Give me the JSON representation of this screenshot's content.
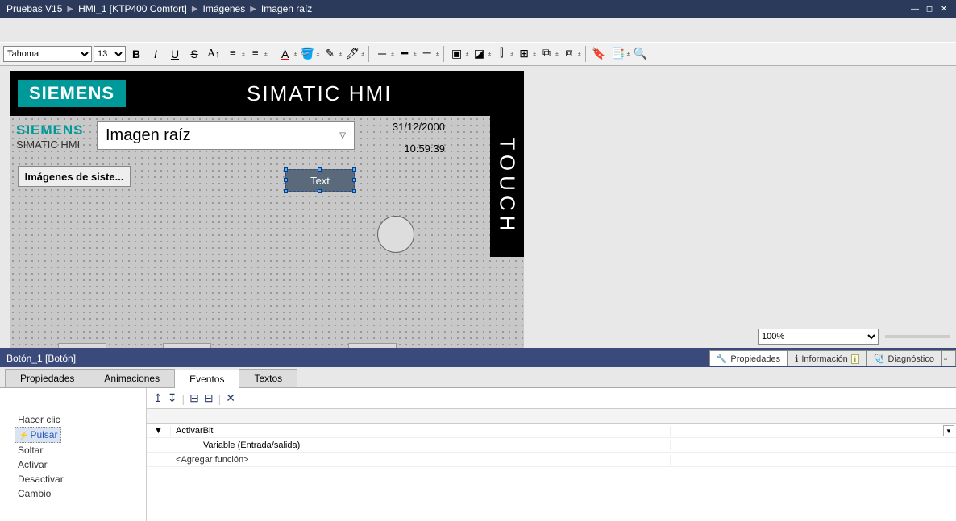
{
  "titlebar": {
    "crumbs": [
      "Pruebas V15",
      "HMI_1 [KTP400 Comfort]",
      "Imágenes",
      "Imagen raíz"
    ]
  },
  "toolbar": {
    "font": "Tahoma",
    "size": "13"
  },
  "hmi": {
    "brand": "SIEMENS",
    "product": "SIMATIC HMI",
    "sub_brand": "SIEMENS",
    "sub_product": "SIMATIC HMI",
    "touch": "TOUCH",
    "screen_title": "Imagen raíz",
    "date": "31/12/2000",
    "time": "10:59:39",
    "sys_btn": "Imágenes de siste...",
    "text_btn": "Text"
  },
  "zoom": "100%",
  "lower": {
    "title": "Botón_1 [Botón]",
    "rtabs": {
      "prop": "Propiedades",
      "info": "Información",
      "diag": "Diagnóstico"
    },
    "tabs": {
      "prop": "Propiedades",
      "anim": "Animaciones",
      "event": "Eventos",
      "text": "Textos"
    },
    "events": {
      "click": "Hacer clic",
      "press": "Pulsar",
      "release": "Soltar",
      "activate": "Activar",
      "deactivate": "Desactivar",
      "change": "Cambio"
    },
    "grid": {
      "func": "ActivarBit",
      "var_label": "Variable (Entrada/salida)",
      "add": "<Agregar función>"
    }
  }
}
